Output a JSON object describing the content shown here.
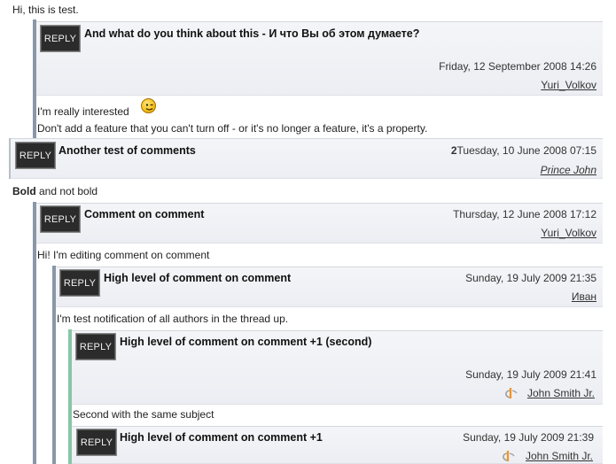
{
  "intro_text": "Hi, this is test.",
  "reply_label": "REPLY",
  "comments": [
    {
      "subject": "And what do you think about this - И что Вы об этом думаете?",
      "date": "Friday, 12 September 2008 14:26",
      "author": "Yuri_Volkov",
      "body": [
        "I'm really interested",
        "Don't add a feature that you can't turn off - or it's no longer a feature, it's a property."
      ]
    },
    {
      "subject": "Another test of comments",
      "count": "2",
      "date": "Tuesday, 10 June 2008 07:15",
      "author": "Prince John",
      "body": [
        "Bold",
        " and not bold"
      ]
    },
    {
      "subject": "Comment on comment",
      "date": "Thursday, 12 June 2008 17:12",
      "author": "Yuri_Volkov",
      "body": [
        "Hi! I'm editing comment on comment"
      ]
    },
    {
      "subject": "High level of comment on comment",
      "date": "Sunday, 19 July 2009 21:35",
      "author": "Иван",
      "body": [
        "I'm test notification of all authors in the thread up."
      ]
    },
    {
      "subject": "High level of comment on comment +1 (second)",
      "date": "Sunday, 19 July 2009 21:41",
      "author": "John Smith Jr.",
      "body": [
        "Second with the same subject"
      ]
    },
    {
      "subject": "High level of comment on comment +1",
      "date": "Sunday, 19 July 2009 21:39",
      "author": "John Smith Jr."
    }
  ],
  "colors": {
    "reply_bg": "#2b2b2b",
    "thread_line_gray": "#8a97a8",
    "thread_line_green": "#88c6a6",
    "header_bg": "#eef0f4"
  },
  "icons": {
    "smiley": "winking-smiley-icon",
    "author_logo": "openid-logo-icon"
  }
}
